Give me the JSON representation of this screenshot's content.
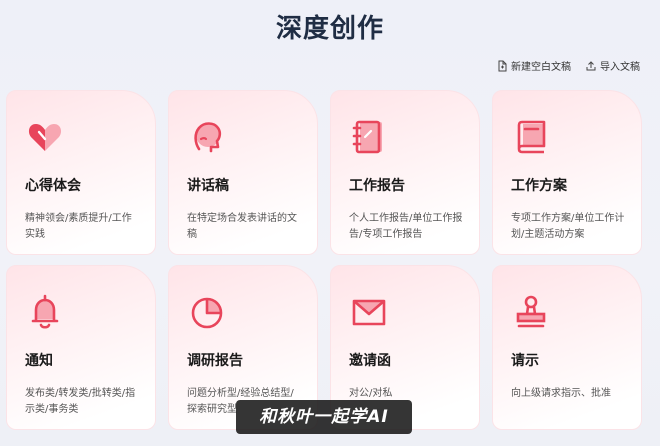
{
  "page": {
    "title": "深度创作"
  },
  "actions": {
    "new_blank": "新建空白文稿",
    "import": "导入文稿"
  },
  "cards": [
    {
      "title": "心得体会",
      "desc": "精神领会/素质提升/工作实践",
      "icon": "heart-icon"
    },
    {
      "title": "讲话稿",
      "desc": "在特定场合发表讲话的文稿",
      "icon": "speaking-head-icon"
    },
    {
      "title": "工作报告",
      "desc": "个人工作报告/单位工作报告/专项工作报告",
      "icon": "notebook-icon"
    },
    {
      "title": "工作方案",
      "desc": "专项工作方案/单位工作计划/主题活动方案",
      "icon": "book-icon"
    },
    {
      "title": "通知",
      "desc": "发布类/转发类/批转类/指示类/事务类",
      "icon": "bell-icon"
    },
    {
      "title": "调研报告",
      "desc": "问题分析型/经验总结型/探索研究型",
      "icon": "pie-chart-icon"
    },
    {
      "title": "邀请函",
      "desc": "对公/对私",
      "icon": "envelope-icon"
    },
    {
      "title": "请示",
      "desc": "向上级请求指示、批准",
      "icon": "stamp-icon"
    }
  ],
  "watermark": "和秋叶一起学AI",
  "colors": {
    "accent": "#e8455b",
    "accent_light": "#f7a6b1",
    "title": "#1f2d44"
  }
}
